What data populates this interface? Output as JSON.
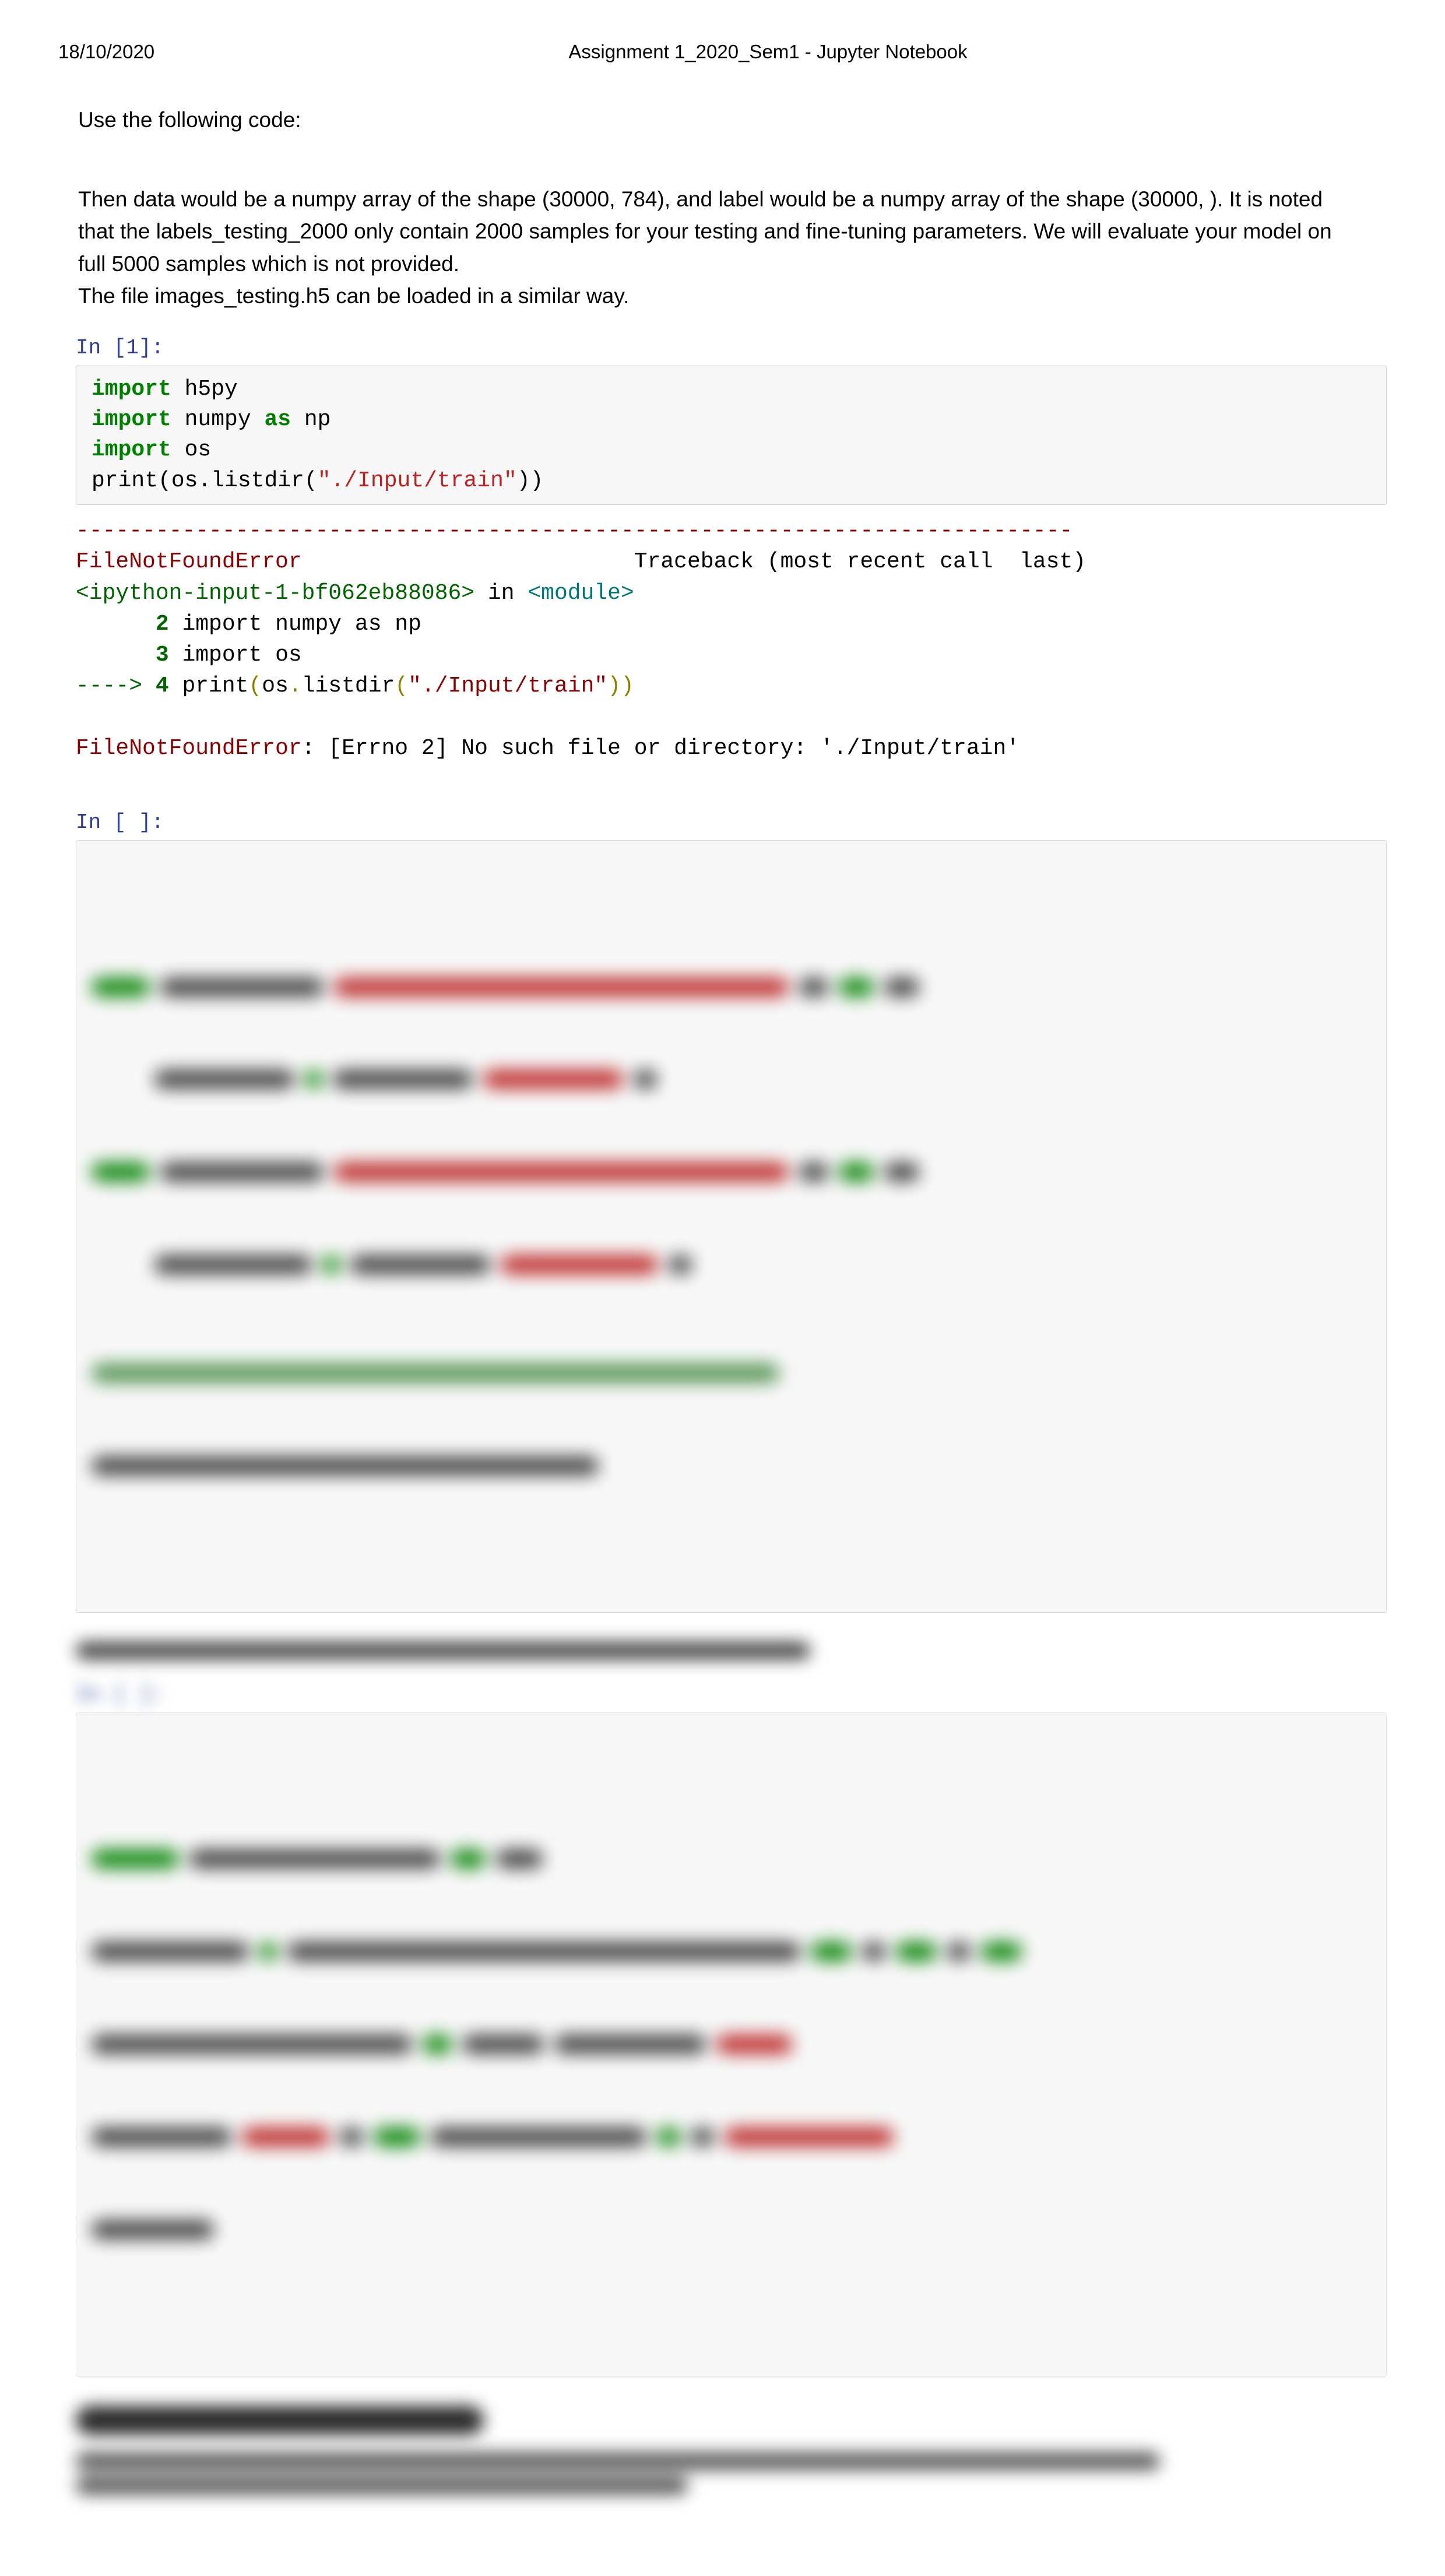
{
  "header": {
    "date": "18/10/2020",
    "title": "Assignment 1_2020_Sem1 - Jupyter Notebook"
  },
  "intro": {
    "line1": "Use the following code:",
    "para1": "Then data would be a numpy array of the shape (30000, 784), and label would be a numpy array of the shape (30000, ). It is noted that the labels_testing_2000 only contain 2000 samples for your testing and fine-tuning parameters. We will evaluate your model on full 5000 samples which is not provided.",
    "para2": "The file images_testing.h5 can be loaded in a similar way."
  },
  "cell1": {
    "prompt": "In [1]:",
    "code_tokens": {
      "import": "import",
      "h5py": " h5py",
      "numpy": " numpy ",
      "as": "as",
      "np": " np",
      "os": " os",
      "print": "print",
      "paren_open": "(os.listdir(",
      "path": "\"./Input/train\"",
      "paren_close": "))"
    },
    "output": {
      "sep": "---------------------------------------------------------------------------",
      "err_name": "FileNotFoundError",
      "err_spaces": "                         ",
      "traceback_label": "Traceback (most recent call  last)",
      "ipython_ref": "<ipython-input-1-bf062eb88086>",
      "in_word": " in ",
      "module_ref": "<module>",
      "line2_num": "      2",
      "line2_txt": " import numpy as np",
      "line3_num": "      3",
      "line3_txt": " import os",
      "arrow": "----> ",
      "line4_num": "4",
      "line4_print": " print",
      "line4_open": "(",
      "line4_os": "os",
      "line4_dot": ".",
      "line4_listdir": "listdir",
      "line4_open2": "(",
      "line4_str": "\"./Input/train\"",
      "line4_close": "))",
      "err_foot_name": "FileNotFoundError",
      "err_foot_rest": ": [Errno 2] No such file or directory: './Input/train'"
    }
  },
  "cell2": {
    "prompt": "In [ ]:"
  },
  "cell3": {
    "prompt": "In [ ]:"
  }
}
